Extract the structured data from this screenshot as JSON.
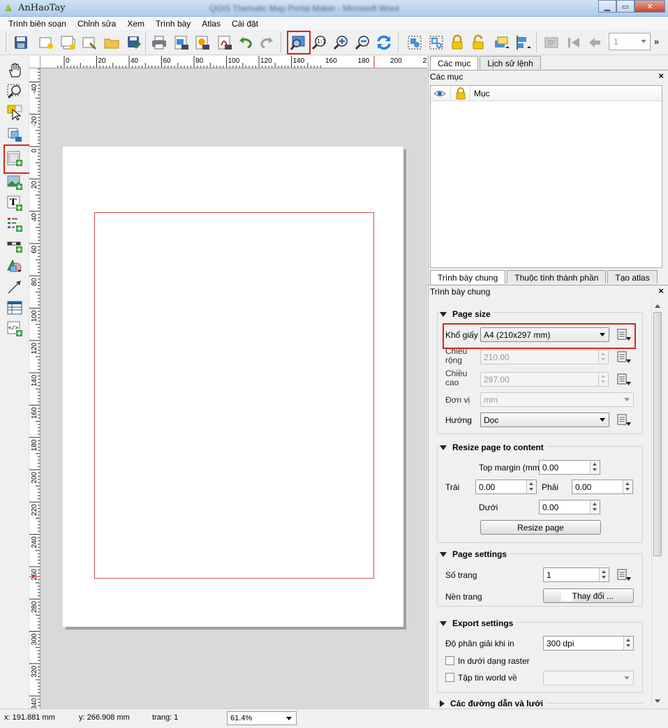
{
  "window": {
    "app_title": "AnHaoTay",
    "blurred_title": "QGIS Thematic Map Portal Maker - Microsoft Word",
    "buttons": [
      "minimize",
      "maximize",
      "close"
    ]
  },
  "menubar": [
    "Trình biên soạn",
    "Chỉnh sửa",
    "Xem",
    "Trình bày",
    "Atlas",
    "Cài đặt"
  ],
  "toolbar": {
    "icons": [
      "save-icon",
      "new-composer-icon",
      "duplicate-composer-icon",
      "composer-manager-icon",
      "open-folder-icon",
      "save-template-icon",
      "print-icon",
      "export-image-icon",
      "export-svg-icon",
      "export-pdf-icon",
      "undo-icon",
      "redo-icon",
      "zoom-full-icon",
      "zoom-actual-icon",
      "zoom-in-icon",
      "zoom-out-icon",
      "refresh-icon",
      "group-icon",
      "ungroup-icon",
      "lock-icon",
      "unlock-icon",
      "raise-items-icon",
      "align-items-icon",
      "atlas-preview-icon",
      "first-feature-icon",
      "previous-feature-icon"
    ],
    "page_number": "1",
    "more": "»"
  },
  "tools": [
    "pan-icon",
    "zoom-tool-icon",
    "select-move-icon",
    "move-content-icon",
    "add-map-icon",
    "add-image-icon",
    "add-label-icon",
    "add-legend-icon",
    "add-scalebar-icon",
    "add-shape-icon",
    "add-arrow-icon",
    "add-table-icon",
    "add-html-icon"
  ],
  "ruler": {
    "h_labels": [
      "0",
      "20",
      "40",
      "60",
      "80",
      "100",
      "120",
      "140",
      "160",
      "180",
      "200",
      "22"
    ],
    "v_labels": [
      "-40",
      "-20",
      "0",
      "20",
      "40",
      "60",
      "80",
      "100",
      "120",
      "140",
      "160",
      "180",
      "200",
      "220",
      "240",
      "260",
      "280",
      "300",
      "320",
      "340"
    ]
  },
  "items_panel": {
    "tabs": [
      "Các mục",
      "Lịch sử lệnh"
    ],
    "title": "Các mục",
    "column_item": "Mục",
    "close": "×"
  },
  "props_panel": {
    "tabs": [
      "Trình bày chung",
      "Thuộc tính thành phần",
      "Tạo atlas"
    ],
    "title": "Trình bày chung",
    "close": "×",
    "page_size": {
      "title": "Page size",
      "paper_label": "Khổ giấy",
      "paper_value": "A4 (210x297 mm)",
      "width_label_1": "Chiều",
      "width_label_2": "rộng",
      "width_value": "210.00",
      "height_label_1": "Chiều",
      "height_label_2": "cao",
      "height_value": "297.00",
      "unit_label": "Đơn vị",
      "unit_value": "mm",
      "orient_label": "Hướng",
      "orient_value": "Dọc"
    },
    "resize": {
      "title": "Resize page to content",
      "top_label": "Top margin (mm)",
      "top_value": "0.00",
      "left_label": "Trái",
      "left_value": "0.00",
      "right_label": "Phải",
      "right_value": "0.00",
      "bottom_label": "Dưới",
      "bottom_value": "0.00",
      "button": "Resize page"
    },
    "page_settings": {
      "title": "Page settings",
      "pages_label": "Số trang",
      "pages_value": "1",
      "bg_label": "Nền trang",
      "bg_button": "Thay đổi ..."
    },
    "export": {
      "title": "Export settings",
      "dpi_label": "Độ phân giải khi in",
      "dpi_value": "300 dpi",
      "raster_label": "In dưới dạng raster",
      "world_label": "Tập tin world về"
    },
    "guides_title": "Các đường dẫn và lưới"
  },
  "statusbar": {
    "x": "x: 191.881 mm",
    "y": "y: 266.908 mm",
    "page": "trang: 1",
    "zoom": "61.4%"
  },
  "colors": {
    "highlight_red": "#d9241c",
    "margin_red": "#d94a4a",
    "canvas_bg": "#d9d9d9"
  }
}
